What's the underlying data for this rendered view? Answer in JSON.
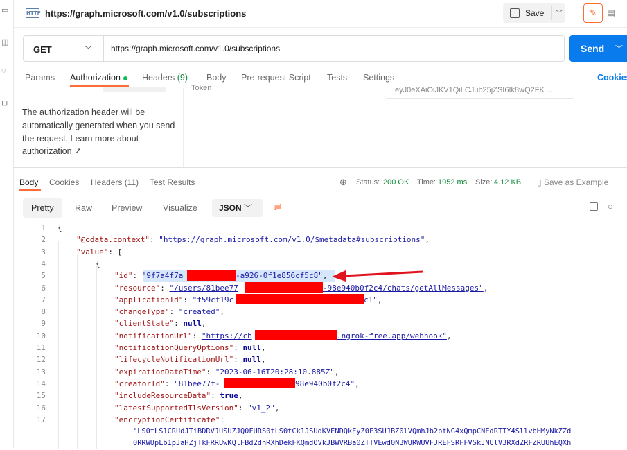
{
  "tab": {
    "icon": "HTTP",
    "title": "https://graph.microsoft.com/v1.0/subscriptions",
    "save_label": "Save"
  },
  "request": {
    "method": "GET",
    "url": "https://graph.microsoft.com/v1.0/subscriptions",
    "send_label": "Send"
  },
  "request_tabs": [
    {
      "label": "Params"
    },
    {
      "label": "Authorization"
    },
    {
      "label": "Headers",
      "count": "(9)"
    },
    {
      "label": "Body"
    },
    {
      "label": "Pre-request Script"
    },
    {
      "label": "Tests"
    },
    {
      "label": "Settings"
    }
  ],
  "cookies_label": "Cookies",
  "auth": {
    "description": "The authorization header will be automatically generated when you send the request. Learn more about",
    "link": "authorization ↗",
    "token_label": "Token",
    "token_value": "eyJ0eXAiOiJKV1QiLCJub25jZSI6Ik8wQ2FK ..."
  },
  "response_tabs": [
    {
      "label": "Body"
    },
    {
      "label": "Cookies"
    },
    {
      "label": "Headers (11)"
    },
    {
      "label": "Test Results"
    }
  ],
  "status": {
    "status_label": "Status:",
    "status_value": "200 OK",
    "time_label": "Time:",
    "time_value": "1952 ms",
    "size_label": "Size:",
    "size_value": "4.12 KB"
  },
  "save_example_label": "Save as Example",
  "viewer": {
    "modes": [
      "Pretty",
      "Raw",
      "Preview",
      "Visualize"
    ],
    "format": "JSON"
  },
  "code_lines": [
    {
      "n": "1"
    },
    {
      "n": "2"
    },
    {
      "n": "3"
    },
    {
      "n": "4"
    },
    {
      "n": "5"
    },
    {
      "n": "6"
    },
    {
      "n": "7"
    },
    {
      "n": "8"
    },
    {
      "n": "9"
    },
    {
      "n": "10"
    },
    {
      "n": "11"
    },
    {
      "n": "12"
    },
    {
      "n": "13"
    },
    {
      "n": "14"
    },
    {
      "n": "15"
    },
    {
      "n": "16"
    },
    {
      "n": "17"
    }
  ],
  "json": {
    "context_key": "\"@odata.context\"",
    "context_val": "\"https://graph.microsoft.com/v1.0/$metadata#subscriptions\"",
    "value_key": "\"value\"",
    "id_key": "\"id\"",
    "id_start": "\"9f7a4f7a",
    "id_end": "-a926-0f1e856cf5c8\"",
    "resource_key": "\"resource\"",
    "resource_start": "\"/users/81bee77",
    "resource_end": "-98e940b0f2c4/chats/getAllMessages\"",
    "appid_key": "\"applicationId\"",
    "appid_start": "\"f59cf19c",
    "appid_end": "c1\"",
    "changetype_key": "\"changeType\"",
    "changetype_val": "\"created\"",
    "clientstate_key": "\"clientState\"",
    "null_val": "null",
    "notif_key": "\"notificationUrl\"",
    "notif_start": "\"https://cb",
    "notif_end": ".ngrok-free.app/webhook\"",
    "nqo_key": "\"notificationQueryOptions\"",
    "lnu_key": "\"lifecycleNotificationUrl\"",
    "exp_key": "\"expirationDateTime\"",
    "exp_val": "\"2023-06-16T20:28:10.885Z\"",
    "creator_key": "\"creatorId\"",
    "creator_start": "\"81bee77f-",
    "creator_end": "98e940b0f2c4\"",
    "incl_key": "\"includeResourceData\"",
    "true_val": "true",
    "tls_key": "\"latestSupportedTlsVersion\"",
    "tls_val": "\"v1_2\"",
    "enc_key": "\"encryptionCertificate\"",
    "enc_line1": "\"LS0tLS1CRUdJTiBDRVJUSUZJQ0FURS0tLS0tCk1JSUdKVENDQkEyZ0F3SUJBZ0lVQmhJb2ptNG4xQmpCNEdRTTY4SllvbHMyNkZZd",
    "enc_line2": "0RRWUpLb1pJaHZjTkFRRUwKQlFBd2dhRXhDekFKQmdOVkJBWVRBa0ZTTVEwd0N3WURWUVFJREFSRFFVSkJNUlV3RXdZRFZRUUhEQXh"
  },
  "colors": {
    "accent": "#ff6c37",
    "send": "#097bed",
    "status_ok": "#0f8a3a",
    "redaction": "#ff0000",
    "arrow": "#e0141e"
  }
}
